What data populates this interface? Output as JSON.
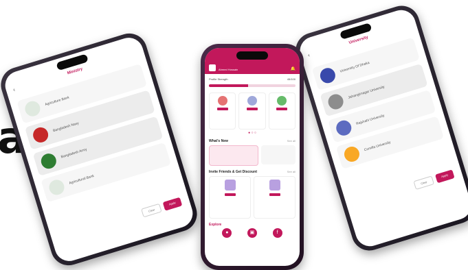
{
  "hero_fragment": "al",
  "left_phone": {
    "title": "Ministry",
    "options": [
      {
        "label": "Agriculture Bank",
        "logo": "#dfe9df",
        "selected": false
      },
      {
        "label": "Bangladesh Navy",
        "logo": "#c62828",
        "selected": true
      },
      {
        "label": "Bangladesh Army",
        "logo": "#2e7d32",
        "selected": true
      },
      {
        "label": "Agricultural Bank",
        "logo": "#dfe9df",
        "selected": false
      }
    ],
    "clear_label": "Clear",
    "apply_label": "Apply"
  },
  "right_phone": {
    "title": "University",
    "options": [
      {
        "label": "University Of Dhaka",
        "logo": "#3949ab",
        "selected": false
      },
      {
        "label": "Jahangirnagar University",
        "logo": "#8d8d8d",
        "selected": true
      },
      {
        "label": "Rajshahi University",
        "logo": "#5c6bc0",
        "selected": false
      },
      {
        "label": "Comilla University",
        "logo": "#f9a825",
        "selected": false
      }
    ],
    "clear_label": "Clear",
    "apply_label": "Apply"
  },
  "center_phone": {
    "user_name": "Ahmed Hossain",
    "profile_label": "Profile Strength",
    "profile_value": "45/100",
    "profile_fraction": 0.45,
    "whats_new_label": "What's New",
    "see_all_label": "See all",
    "invite_label": "Invite Friends & Get Discount",
    "explore_label": "Explore"
  },
  "colors": {
    "accent": "#c2185b"
  }
}
